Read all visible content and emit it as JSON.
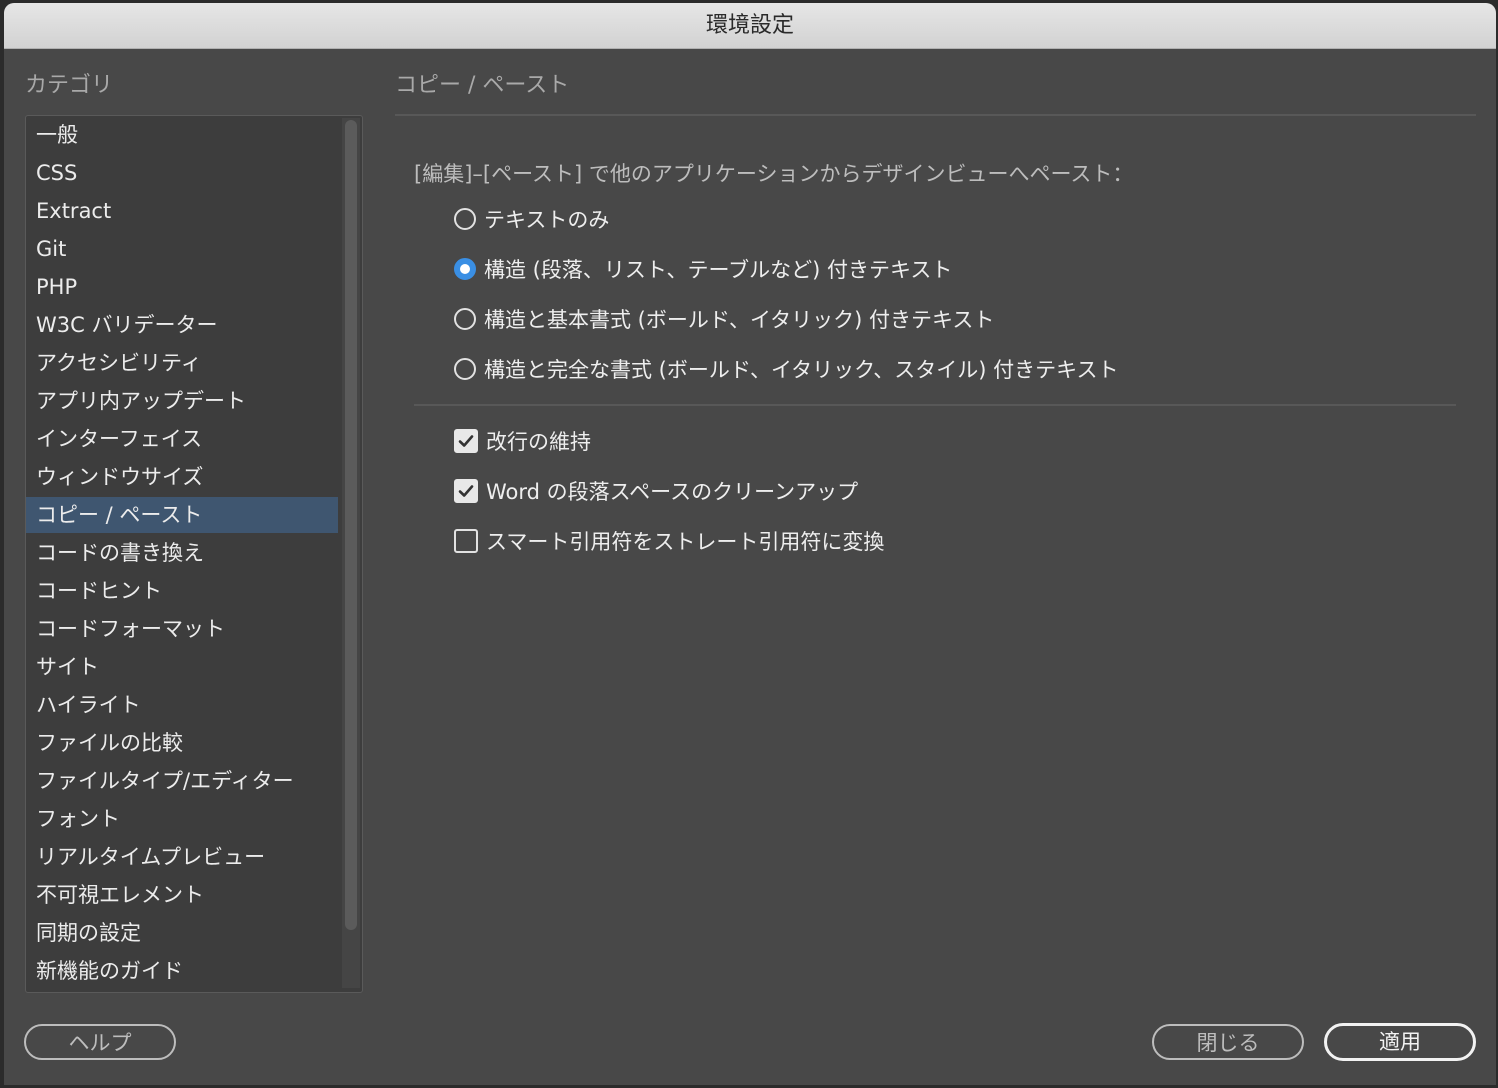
{
  "window": {
    "title": "環境設定"
  },
  "sidebar": {
    "heading": "カテゴリ",
    "items": [
      {
        "label": "一般"
      },
      {
        "label": "CSS"
      },
      {
        "label": "Extract"
      },
      {
        "label": "Git"
      },
      {
        "label": "PHP"
      },
      {
        "label": "W3C バリデーター"
      },
      {
        "label": "アクセシビリティ"
      },
      {
        "label": "アプリ内アップデート"
      },
      {
        "label": "インターフェイス"
      },
      {
        "label": "ウィンドウサイズ"
      },
      {
        "label": "コピー / ペースト",
        "selected": true
      },
      {
        "label": "コードの書き換え"
      },
      {
        "label": "コードヒント"
      },
      {
        "label": "コードフォーマット"
      },
      {
        "label": "サイト"
      },
      {
        "label": "ハイライト"
      },
      {
        "label": "ファイルの比較"
      },
      {
        "label": "ファイルタイプ/エディター"
      },
      {
        "label": "フォント"
      },
      {
        "label": "リアルタイムプレビュー"
      },
      {
        "label": "不可視エレメント"
      },
      {
        "label": "同期の設定"
      },
      {
        "label": "新機能のガイド"
      }
    ]
  },
  "panel": {
    "title": "コピー / ペースト",
    "paste_label": "[編集]–[ペースト] で他のアプリケーションからデザインビューへペースト：",
    "radio_options": [
      {
        "label": "テキストのみ",
        "checked": false
      },
      {
        "label": "構造 (段落、リスト、テーブルなど) 付きテキスト",
        "checked": true
      },
      {
        "label": "構造と基本書式 (ボールド、イタリック) 付きテキスト",
        "checked": false
      },
      {
        "label": "構造と完全な書式 (ボールド、イタリック、スタイル) 付きテキスト",
        "checked": false
      }
    ],
    "checkboxes": [
      {
        "label": "改行の維持",
        "checked": true
      },
      {
        "label": "Word の段落スペースのクリーンアップ",
        "checked": true
      },
      {
        "label": "スマート引用符をストレート引用符に変換",
        "checked": false
      }
    ]
  },
  "footer": {
    "help_label": "ヘルプ",
    "close_label": "閉じる",
    "apply_label": "適用"
  },
  "colors": {
    "background": "#484848",
    "selected_row": "#3f5670",
    "radio_accent": "#3a8fe4"
  }
}
